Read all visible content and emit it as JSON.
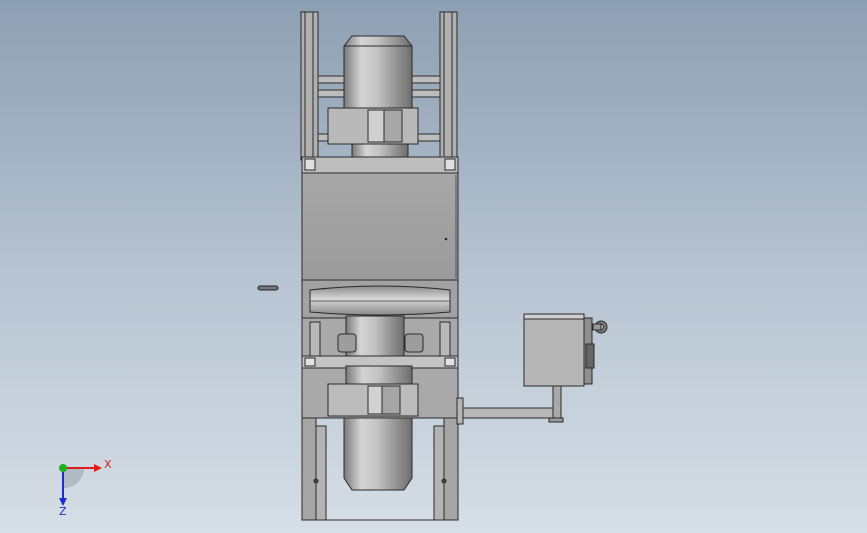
{
  "colors": {
    "background_top": "#8d9fb3",
    "background_bottom": "#d6dee6",
    "steel": "#9a9a9a",
    "steel_light": "#c8c8c8",
    "edge": "#2a2a2a",
    "axis_x": "#e21b1b",
    "axis_y": "#1fb01f",
    "axis_z": "#1b2fd0"
  },
  "triad": {
    "x_label": "X",
    "z_label": "Z"
  },
  "icons": {
    "triad": "coordinate-triad-icon"
  }
}
